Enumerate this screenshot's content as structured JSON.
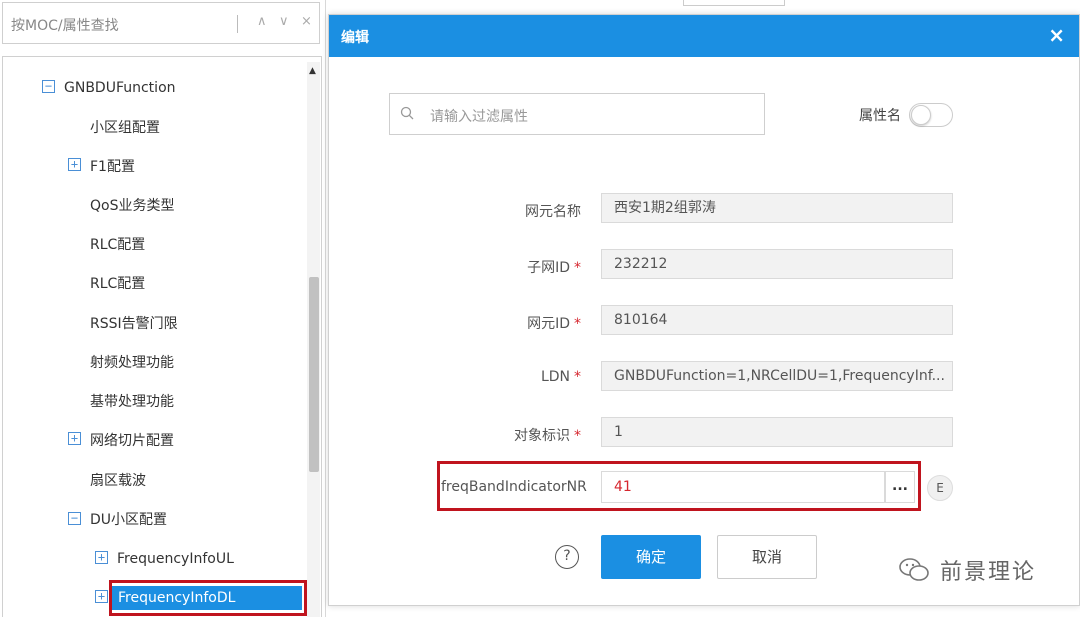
{
  "left_panel": {
    "search_placeholder": "按MOC/属性查找",
    "tree": [
      {
        "label": "GNBDUFunction",
        "toggle": "−"
      },
      {
        "label": "小区组配置"
      },
      {
        "label": "F1配置",
        "toggle": "+"
      },
      {
        "label": "QoS业务类型"
      },
      {
        "label": "RLC配置"
      },
      {
        "label": "RLC配置"
      },
      {
        "label": "RSSI告警门限"
      },
      {
        "label": "射频处理功能"
      },
      {
        "label": "基带处理功能"
      },
      {
        "label": "网络切片配置",
        "toggle": "+"
      },
      {
        "label": "扇区载波"
      },
      {
        "label": "DU小区配置",
        "toggle": "−"
      },
      {
        "label": "FrequencyInfoUL",
        "toggle": "+"
      },
      {
        "label": "FrequencyInfoDL",
        "toggle": "+",
        "selected": true
      }
    ]
  },
  "dialog": {
    "title": "编辑",
    "close": "×",
    "filter_placeholder": "请输入过滤属性",
    "toggle_label": "属性名",
    "fields": [
      {
        "label": "网元名称",
        "required": false,
        "value": "西安1期2组郭涛"
      },
      {
        "label": "子网ID",
        "required": true,
        "value": "232212"
      },
      {
        "label": "网元ID",
        "required": true,
        "value": "810164"
      },
      {
        "label": "LDN",
        "required": true,
        "value": "GNBDUFunction=1,NRCellDU=1,FrequencyInf..."
      },
      {
        "label": "对象标识",
        "required": true,
        "value": "1"
      }
    ],
    "freq": {
      "label": "freqBandIndicatorNR",
      "value": "41",
      "button": "...",
      "extra": "E"
    },
    "help": "?",
    "ok": "确定",
    "cancel": "取消"
  },
  "watermark": "前景理论",
  "colors": {
    "accent": "#1b8fe2",
    "highlight_border": "#c0141e",
    "required": "#d6262e"
  }
}
